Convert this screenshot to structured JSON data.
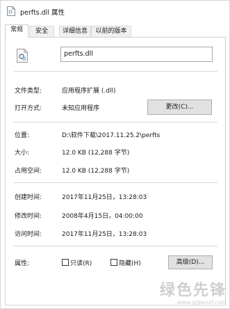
{
  "window": {
    "title": "perfts.dll 属性"
  },
  "tabs": [
    {
      "label": "常规"
    },
    {
      "label": "安全"
    },
    {
      "label": "详细信息"
    },
    {
      "label": "以前的版本"
    }
  ],
  "general": {
    "file_name": "perfts.dll",
    "file_type": {
      "label": "文件类型:",
      "value": "应用程序扩展 (.dll)"
    },
    "opens_with": {
      "label": "打开方式:",
      "value": "未知应用程序",
      "button": "更改(C)..."
    },
    "location": {
      "label": "位置:",
      "value": "D:\\软件下载\\2017.11.25.2\\perfts"
    },
    "size": {
      "label": "大小:",
      "value": "12.0 KB (12,288 字节)"
    },
    "size_on_disk": {
      "label": "占用空间:",
      "value": "12.0 KB (12,288 字节)"
    },
    "created": {
      "label": "创建时间:",
      "value": "2017年11月25日，13:28:03"
    },
    "modified": {
      "label": "修改时间:",
      "value": "2008年4月15日，04:00:00"
    },
    "accessed": {
      "label": "访问时间:",
      "value": "2017年11月25日，13:28:03"
    },
    "attributes": {
      "label": "属性:",
      "readonly": "只读(R)",
      "hidden": "隐藏(H)",
      "advanced_button": "高级(D)..."
    }
  },
  "watermark": {
    "text": "绿色先锋",
    "url": "www.greenxf.com"
  },
  "colors": {
    "window_border": "#d6d6d6",
    "button_bg": "#e1e1e1",
    "tab_bg": "#f0f0f0"
  }
}
